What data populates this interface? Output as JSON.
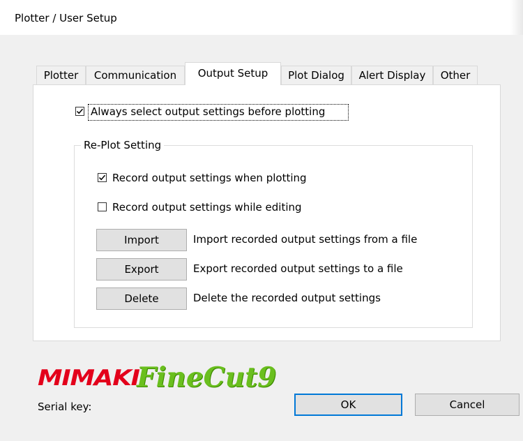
{
  "window": {
    "title": "Plotter / User Setup"
  },
  "tabs": [
    {
      "label": "Plotter",
      "active": false
    },
    {
      "label": "Communication",
      "active": false
    },
    {
      "label": "Output Setup",
      "active": true
    },
    {
      "label": "Plot Dialog",
      "active": false
    },
    {
      "label": "Alert Display",
      "active": false
    },
    {
      "label": "Other",
      "active": false
    }
  ],
  "output_setup": {
    "always_select": {
      "label": "Always select output settings before plotting",
      "checked": true
    },
    "replot_group": {
      "title": "Re-Plot Setting",
      "record_when_plotting": {
        "label": "Record output settings when plotting",
        "checked": true
      },
      "record_while_editing": {
        "label": "Record output settings while editing",
        "checked": false
      },
      "import": {
        "button": "Import",
        "description": "Import recorded output settings from a file"
      },
      "export": {
        "button": "Export",
        "description": "Export recorded output settings to a file"
      },
      "delete": {
        "button": "Delete",
        "description": "Delete the recorded output settings"
      }
    }
  },
  "footer": {
    "brand": "MIMAKI",
    "product": "FineCut9",
    "serial_label": "Serial key:",
    "ok_label": "OK",
    "cancel_label": "Cancel"
  },
  "colors": {
    "accent": "#0078d7",
    "mimaki_red": "#e3001b",
    "finecut_green": "#6abf1e"
  }
}
